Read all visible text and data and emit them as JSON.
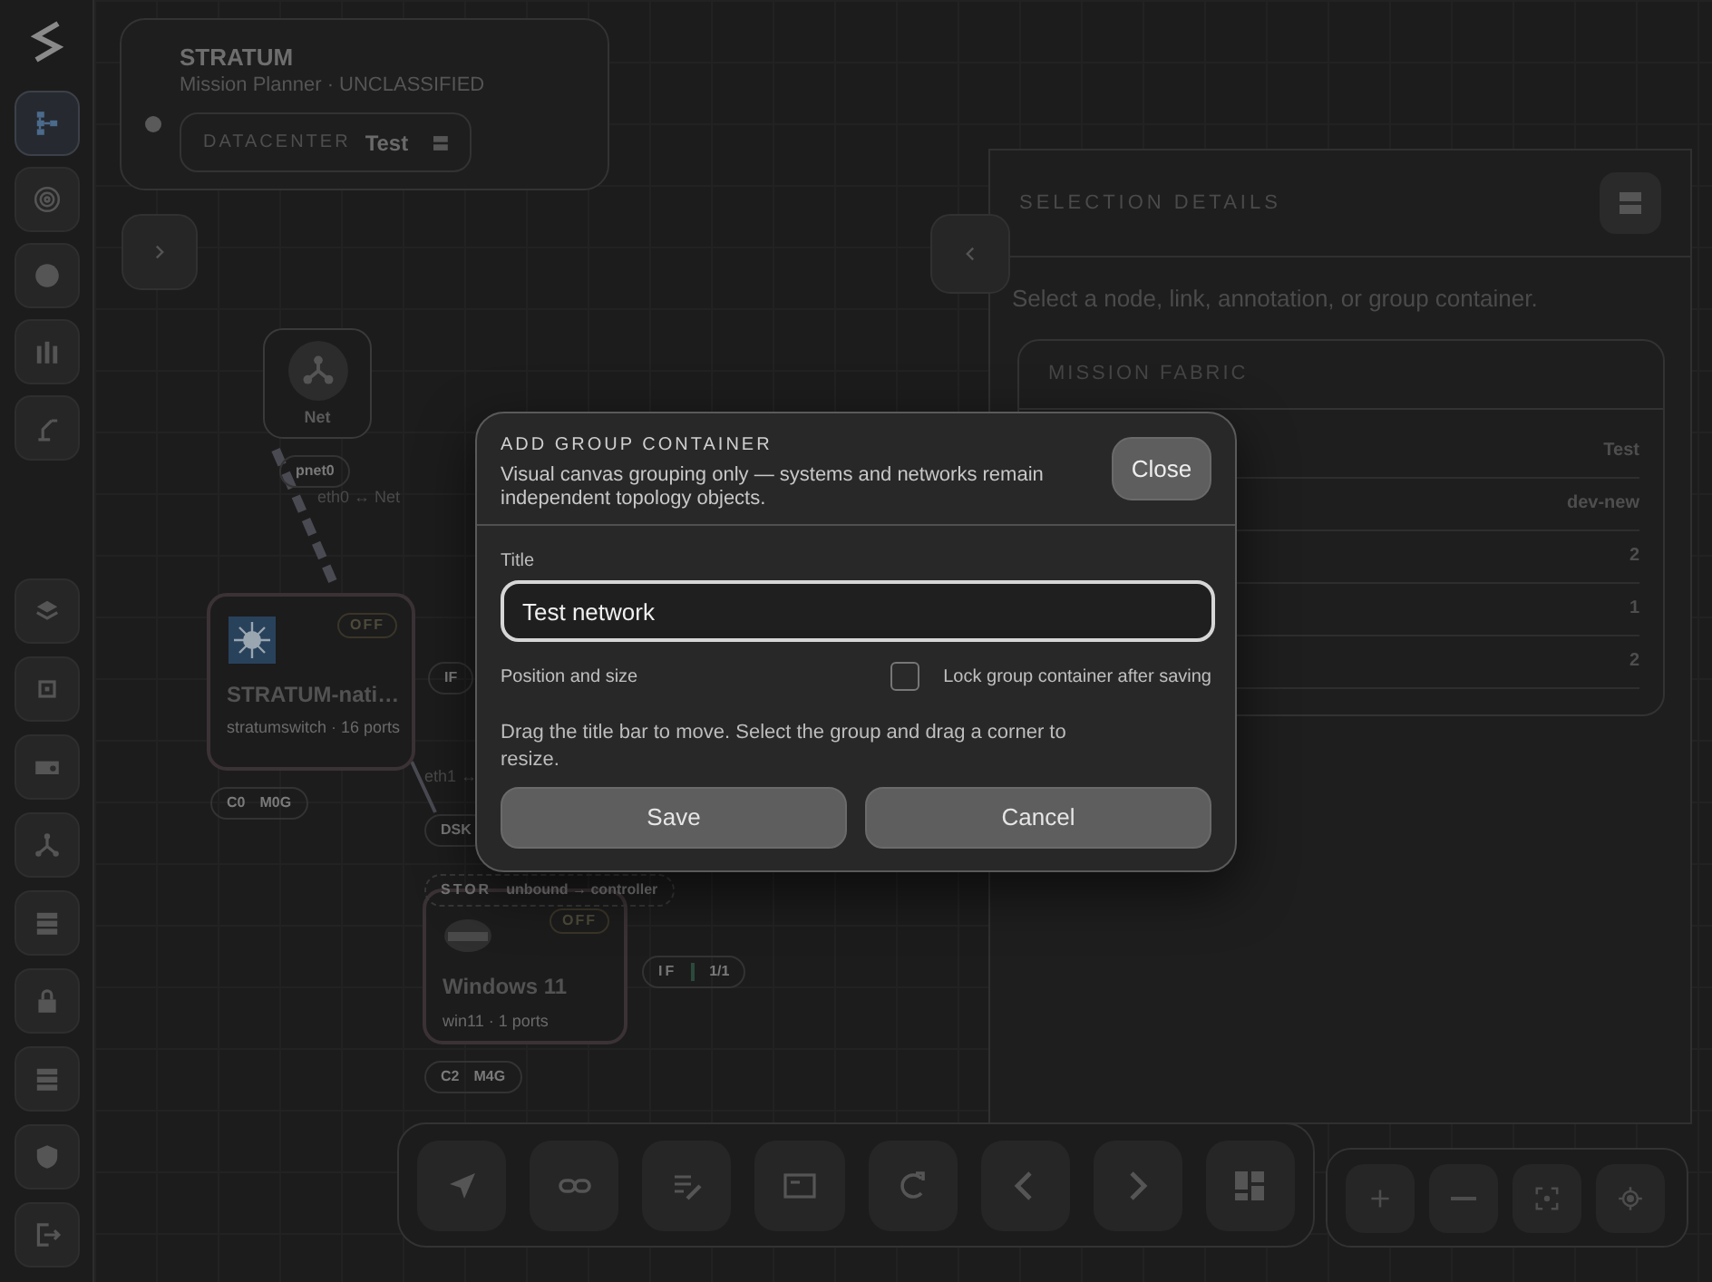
{
  "sidebar": {
    "top_tools": [
      {
        "selected": true
      },
      {
        "selected": false
      },
      {
        "selected": false
      },
      {
        "selected": false
      },
      {
        "selected": false
      }
    ]
  },
  "header": {
    "title": "STRATUM",
    "subtitle": "Mission Planner · UNCLASSIFIED",
    "datacenter_label": "DATACENTER",
    "datacenter_value": "Test"
  },
  "canvas": {
    "nodes": [
      {
        "kind": "network",
        "label": "Net"
      },
      {
        "kind": "switch",
        "title": "STRATUM-nati…",
        "subtitle": "stratumswitch · 16 ports",
        "status": "OFF"
      },
      {
        "kind": "vm",
        "title": "Windows 11",
        "subtitle": "win11 · 1 ports",
        "status": "OFF"
      }
    ],
    "tags": [
      {
        "kind": "pill",
        "parts": [
          "pnet0"
        ]
      },
      {
        "kind": "text",
        "parts": [
          "eth0 ↔ Net"
        ]
      },
      {
        "kind": "pill",
        "parts": [
          "C0",
          "M0G"
        ]
      },
      {
        "kind": "pill",
        "parts": [
          "IF"
        ]
      },
      {
        "kind": "text",
        "parts": [
          "eth1 ↔"
        ]
      },
      {
        "kind": "pill",
        "parts": [
          "DSK"
        ]
      },
      {
        "kind": "dashed",
        "parts": [
          "STOR",
          "unbound → controller"
        ]
      },
      {
        "kind": "meter",
        "parts": [
          "IF",
          "1/1"
        ]
      },
      {
        "kind": "pill",
        "parts": [
          "C2",
          "M4G"
        ]
      }
    ]
  },
  "selection": {
    "title": "SELECTION DETAILS",
    "hint": "Select a node, link, annotation, or group container.",
    "card": {
      "title": "MISSION FABRIC",
      "values": [
        "Test",
        "dev-new",
        "2",
        "1",
        "2"
      ]
    }
  },
  "dialog": {
    "title": "ADD GROUP CONTAINER",
    "description": "Visual canvas grouping only — systems and networks remain independent topology objects.",
    "close": "Close",
    "field_label": "Title",
    "field_value": "Test network",
    "section": "Position and size",
    "lock": {
      "label": "Lock group container after saving",
      "checked": false
    },
    "help": "Drag the title bar to move. Select the group and drag a corner to resize.",
    "buttons": [
      {
        "label": "Save"
      },
      {
        "label": "Cancel"
      }
    ]
  }
}
